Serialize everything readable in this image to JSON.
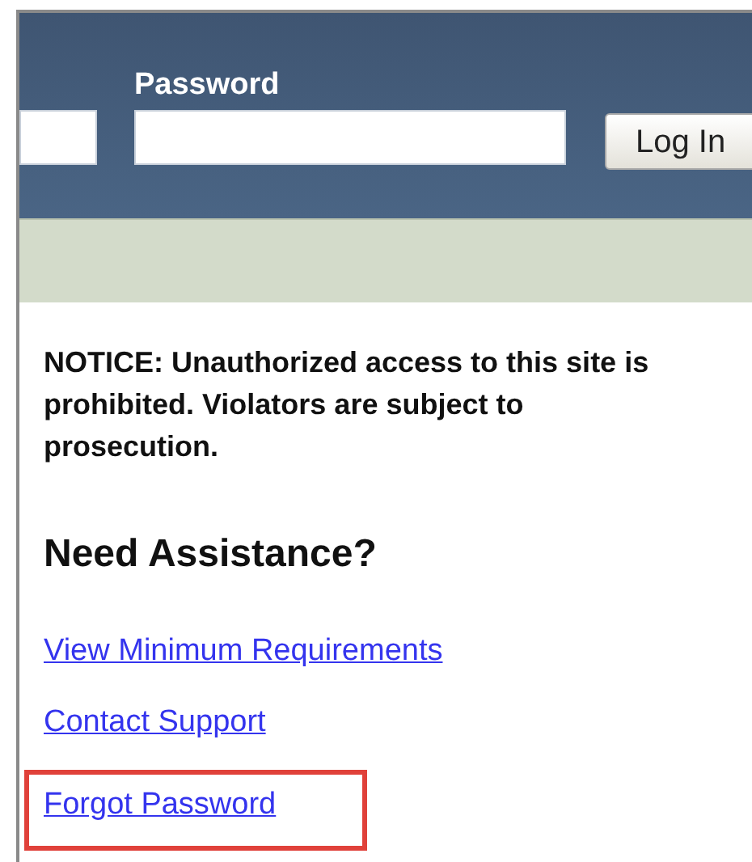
{
  "login_bar": {
    "password_label": "Password",
    "login_button": "Log In"
  },
  "notice": "NOTICE: Unauthorized access to this site is prohibited. Violators are subject to prosecution.",
  "assistance": {
    "heading": "Need Assistance?",
    "links": [
      {
        "label": "View Minimum Requirements",
        "highlighted": false
      },
      {
        "label": "Contact Support",
        "highlighted": false
      },
      {
        "label": "Forgot Password",
        "highlighted": true
      }
    ]
  }
}
